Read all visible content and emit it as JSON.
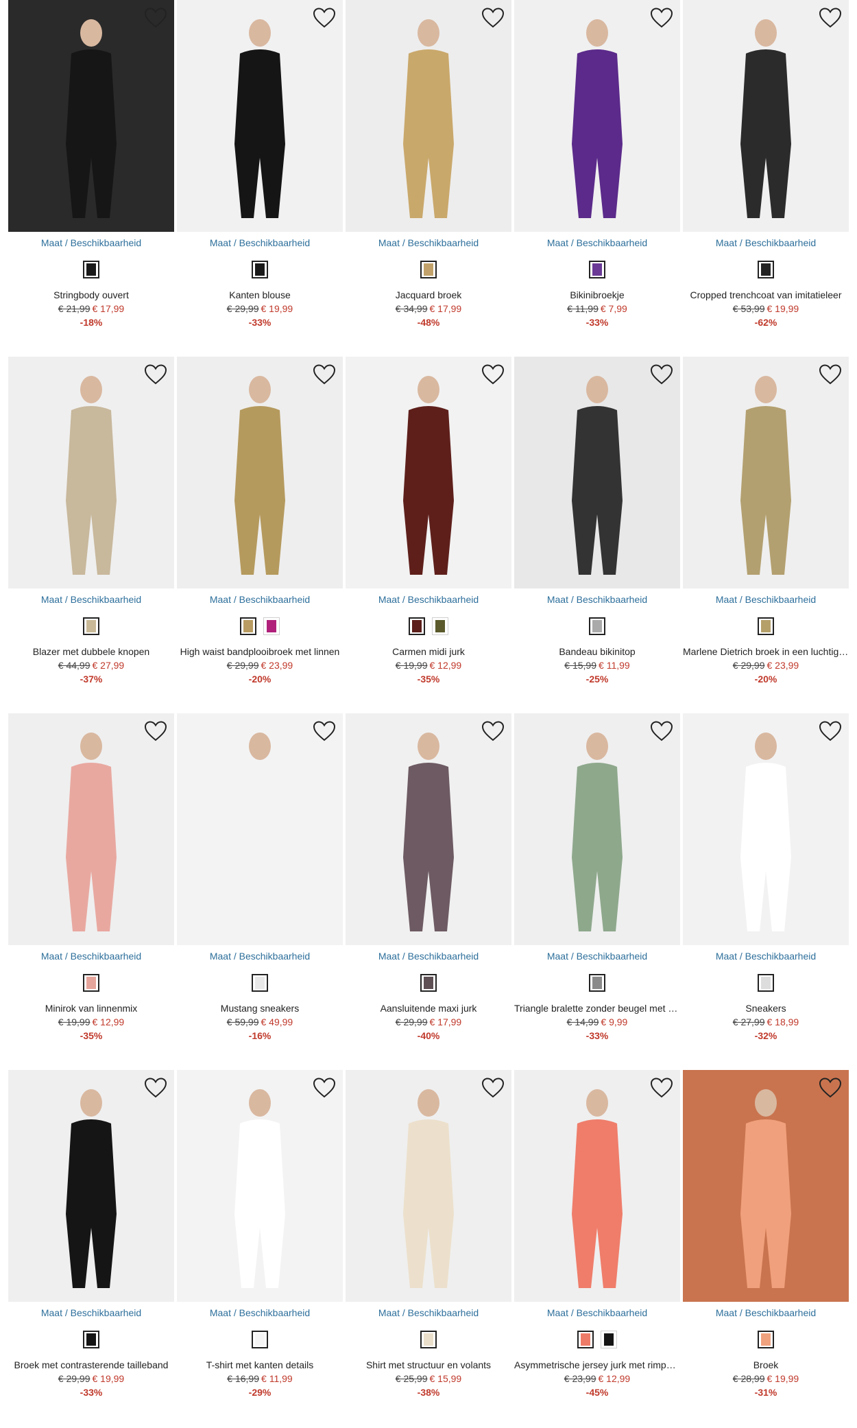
{
  "common": {
    "maat_label": "Maat",
    "separator": " / ",
    "beschikbaarheid_label": "Beschikbaarheid"
  },
  "colors": {
    "link": "#2d6f9b",
    "sale_price": "#c0392b",
    "text": "#222222"
  },
  "products": [
    {
      "name": "Stringbody ouvert",
      "old_price": "€ 21,99",
      "new_price": "€ 17,99",
      "discount": "-18%",
      "photo_bg": "#2a2a2a",
      "garment": "#161616",
      "swatches": [
        "#1a1a1a"
      ]
    },
    {
      "name": "Kanten blouse",
      "old_price": "€ 29,99",
      "new_price": "€ 19,99",
      "discount": "-33%",
      "photo_bg": "#f1f1f1",
      "garment": "#151515",
      "swatches": [
        "#1a1a1a"
      ]
    },
    {
      "name": "Jacquard broek",
      "old_price": "€ 34,99",
      "new_price": "€ 17,99",
      "discount": "-48%",
      "photo_bg": "#ededed",
      "garment": "#c9a86b",
      "swatches": [
        "#c2a26a"
      ]
    },
    {
      "name": "Bikinibroekje",
      "old_price": "€ 11,99",
      "new_price": "€ 7,99",
      "discount": "-33%",
      "photo_bg": "#f0f0f0",
      "garment": "#5b2a8a",
      "swatches": [
        "#6a3a96"
      ]
    },
    {
      "name": "Cropped trenchcoat van imitatieleer",
      "old_price": "€ 53,99",
      "new_price": "€ 19,99",
      "discount": "-62%",
      "photo_bg": "#f0f0f0",
      "garment": "#2b2b2b",
      "swatches": [
        "#222222"
      ]
    },
    {
      "name": "Blazer met dubbele knopen",
      "old_price": "€ 44,99",
      "new_price": "€ 27,99",
      "discount": "-37%",
      "photo_bg": "#efefef",
      "garment": "#c8b89c",
      "swatches": [
        "#c9b997"
      ]
    },
    {
      "name": "High waist bandplooibroek met linnen",
      "old_price": "€ 29,99",
      "new_price": "€ 23,99",
      "discount": "-20%",
      "photo_bg": "#eeeeee",
      "garment": "#b59a5e",
      "swatches": [
        "#b89c62",
        "#b0207a"
      ]
    },
    {
      "name": "Carmen midi jurk",
      "old_price": "€ 19,99",
      "new_price": "€ 12,99",
      "discount": "-35%",
      "photo_bg": "#f2f2f2",
      "garment": "#5e1f1b",
      "swatches": [
        "#5b1e1a",
        "#5a5a2c"
      ]
    },
    {
      "name": "Bandeau bikinitop",
      "old_price": "€ 15,99",
      "new_price": "€ 11,99",
      "discount": "-25%",
      "photo_bg": "#e8e8e8",
      "garment": "#333333",
      "swatches": [
        "#aaaaaa"
      ]
    },
    {
      "name": "Marlene Dietrich broek in een luchtige stof",
      "old_price": "€ 29,99",
      "new_price": "€ 23,99",
      "discount": "-20%",
      "photo_bg": "#efefef",
      "garment": "#b3a070",
      "swatches": [
        "#b5a06a"
      ]
    },
    {
      "name": "Minirok van linnenmix",
      "old_price": "€ 19,99",
      "new_price": "€ 12,99",
      "discount": "-35%",
      "photo_bg": "#efefef",
      "garment": "#e8a8a0",
      "swatches": [
        "#e6a59c"
      ]
    },
    {
      "name": "Mustang sneakers",
      "old_price": "€ 59,99",
      "new_price": "€ 49,99",
      "discount": "-16%",
      "photo_bg": "#f3f3f3",
      "garment": "#f3f3f3",
      "swatches": [
        "#e8e8e8"
      ]
    },
    {
      "name": "Aansluitende maxi jurk",
      "old_price": "€ 29,99",
      "new_price": "€ 17,99",
      "discount": "-40%",
      "photo_bg": "#f0f0f0",
      "garment": "#6d5a62",
      "swatches": [
        "#5e5055"
      ]
    },
    {
      "name": "Triangle bralette zonder beugel met kant",
      "old_price": "€ 14,99",
      "new_price": "€ 9,99",
      "discount": "-33%",
      "photo_bg": "#efefef",
      "garment": "#8ea88c",
      "swatches": [
        "#8a8a8a"
      ]
    },
    {
      "name": "Sneakers",
      "old_price": "€ 27,99",
      "new_price": "€ 18,99",
      "discount": "-32%",
      "photo_bg": "#f2f2f2",
      "garment": "#ffffff",
      "swatches": [
        "#dddddd"
      ]
    },
    {
      "name": "Broek met contrasterende tailleband",
      "old_price": "€ 29,99",
      "new_price": "€ 19,99",
      "discount": "-33%",
      "photo_bg": "#efefef",
      "garment": "#151515",
      "swatches": [
        "#151515"
      ]
    },
    {
      "name": "T-shirt met kanten details",
      "old_price": "€ 16,99",
      "new_price": "€ 11,99",
      "discount": "-29%",
      "photo_bg": "#f3f3f3",
      "garment": "#ffffff",
      "swatches": [
        "#f5f5f5"
      ]
    },
    {
      "name": "Shirt met structuur en volants",
      "old_price": "€ 25,99",
      "new_price": "€ 15,99",
      "discount": "-38%",
      "photo_bg": "#efefef",
      "garment": "#ece0cc",
      "swatches": [
        "#eadfca"
      ]
    },
    {
      "name": "Asymmetrische jersey jurk met rimpeling",
      "old_price": "€ 23,99",
      "new_price": "€ 12,99",
      "discount": "-45%",
      "photo_bg": "#efefef",
      "garment": "#ef7d6a",
      "swatches": [
        "#ee7b68",
        "#151515"
      ]
    },
    {
      "name": "Broek",
      "old_price": "€ 28,99",
      "new_price": "€ 19,99",
      "discount": "-31%",
      "photo_bg": "#c9744f",
      "garment": "#f0a07c",
      "swatches": [
        "#f0a17e"
      ]
    }
  ]
}
